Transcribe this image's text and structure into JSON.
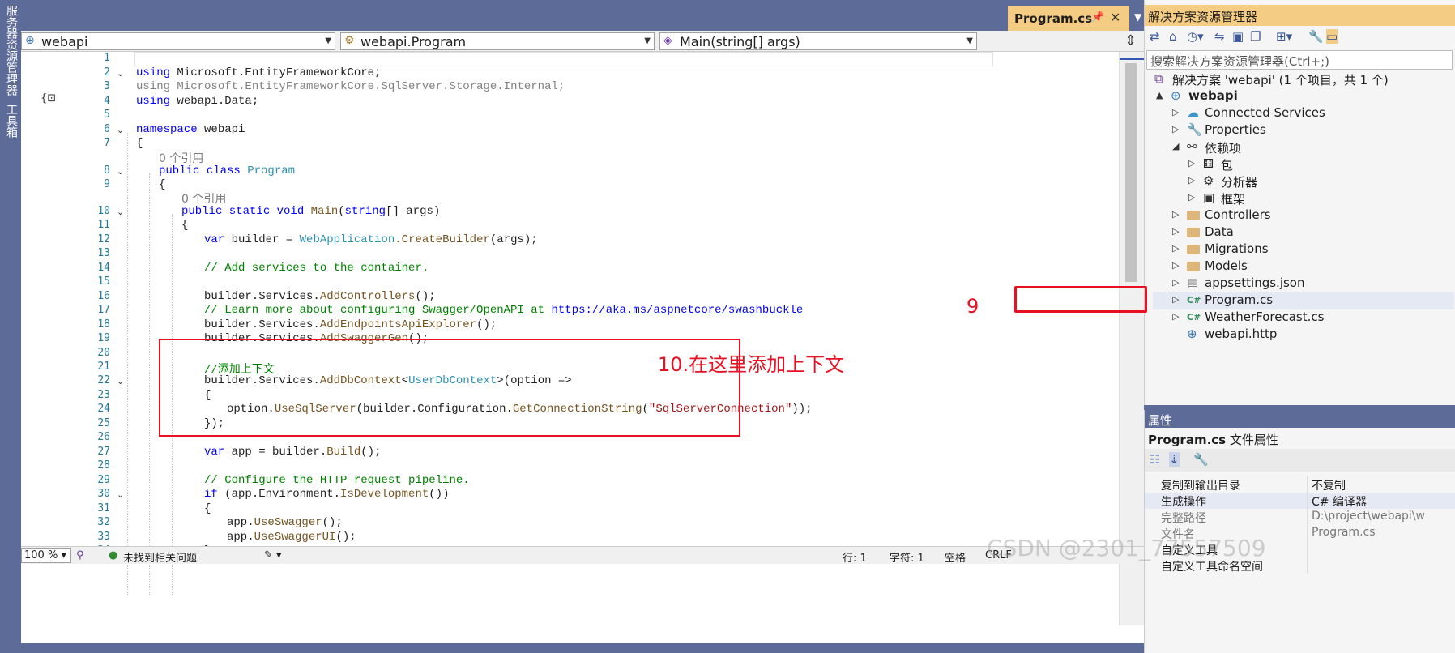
{
  "side_strip": {
    "server_explorer": "服务器资源管理器",
    "toolbox": "工具箱"
  },
  "tab": {
    "label": "Program.cs",
    "pin": "📌",
    "close": "✕"
  },
  "navbar": {
    "project": "webapi",
    "class": "webapi.Program",
    "member": "Main(string[] args)"
  },
  "line_numbers": [
    "1",
    "2",
    "3",
    "4",
    "5",
    "6",
    "7",
    "",
    "8",
    "9",
    "",
    "10",
    "11",
    "12",
    "13",
    "14",
    "15",
    "16",
    "17",
    "18",
    "19",
    "20",
    "21",
    "22",
    "23",
    "24",
    "25",
    "26",
    "27",
    "28",
    "29",
    "30",
    "31",
    "32",
    "33",
    "34"
  ],
  "code": {
    "l2a": "using",
    "l2b": " Microsoft.EntityFrameworkCore;",
    "l3": "using Microsoft.EntityFrameworkCore.SqlServer.Storage.Internal;",
    "l4a": "using",
    "l4b": " webapi.Data;",
    "l6a": "namespace",
    "l6b": " webapi",
    "l7": "{",
    "lens1": "0 个引用",
    "l8a": "public class ",
    "l8b": "Program",
    "l9": "{",
    "lens2": "0 个引用",
    "l10a": "public static void ",
    "l10b": "Main",
    "l10c": "(",
    "l10d": "string",
    "l10e": "[] args)",
    "l11": "{",
    "l12a": "var",
    "l12b": " builder = ",
    "l12c": "WebApplication",
    ".l12d": "",
    "l12e": ".CreateBuilder",
    "l12f": "(args);",
    "l14": "// Add services to the container.",
    "l16a": "builder.Services.",
    "l16b": "AddControllers",
    "l16c": "();",
    "l17a": "// Learn more about configuring Swagger/OpenAPI at ",
    "l17b": "https://aka.ms/aspnetcore/swashbuckle",
    "l18a": "builder.Services.",
    "l18b": "AddEndpointsApiExplorer",
    "l18c": "();",
    "l19a": "builder.Services.",
    "l19b": "AddSwaggerGen",
    "l19c": "();",
    "l21": "//添加上下文",
    "l22a": "builder.Services.",
    "l22b": "AddDbContext",
    "l22c": "<",
    "l22d": "UserDbContext",
    "l22e": ">(option =>",
    "l23": "{",
    "l24a": "option.",
    "l24b": "UseSqlServer",
    "l24c": "(builder.Configuration.",
    "l24d": "GetConnectionString",
    "l24e": "(",
    "l24f": "\"SqlServerConnection\"",
    "l24g": "));",
    "l25": "});",
    "l27a": "var",
    "l27b": " app = builder.",
    "l27c": "Build",
    "l27d": "();",
    "l29": "// Configure the HTTP request pipeline.",
    "l30a": "if",
    "l30b": " (app.Environment.",
    "l30c": "IsDevelopment",
    "l30d": "())",
    "l31": "{",
    "l32a": "app.",
    "l32b": "UseSwagger",
    "l32c": "();",
    "l33a": "app.",
    "l33b": "UseSwaggerUI",
    "l33c": "();",
    "l34": "}"
  },
  "annotations": {
    "step10": "10.在这里添加上下文",
    "step9": "9"
  },
  "status": {
    "zoom": "100 %",
    "issues": "未找到相关问题",
    "line": "行: 1",
    "char": "字符: 1",
    "space": "空格",
    "eol": "CRLF"
  },
  "solution_explorer": {
    "title": "解决方案资源管理器",
    "search_placeholder": "搜索解决方案资源管理器(Ctrl+;)",
    "items": [
      {
        "label": "解决方案 'webapi' (1 个项目，共 1 个)",
        "icon": "solution-icon"
      },
      {
        "label": "webapi",
        "icon": "project-icon"
      },
      {
        "label": "Connected Services",
        "icon": "cloud-icon"
      },
      {
        "label": "Properties",
        "icon": "wrench-icon"
      },
      {
        "label": "依赖项",
        "icon": "dependencies-icon"
      },
      {
        "label": "包",
        "icon": "package-icon"
      },
      {
        "label": "分析器",
        "icon": "analyzer-icon"
      },
      {
        "label": "框架",
        "icon": "framework-icon"
      },
      {
        "label": "Controllers",
        "icon": "folder-icon"
      },
      {
        "label": "Data",
        "icon": "folder-icon"
      },
      {
        "label": "Migrations",
        "icon": "folder-icon"
      },
      {
        "label": "Models",
        "icon": "folder-icon"
      },
      {
        "label": "appsettings.json",
        "icon": "json-icon"
      },
      {
        "label": "Program.cs",
        "icon": "csharp-icon"
      },
      {
        "label": "WeatherForecast.cs",
        "icon": "csharp-icon"
      },
      {
        "label": "webapi.http",
        "icon": "http-icon"
      }
    ]
  },
  "properties": {
    "title": "属性",
    "object_name": "Program.cs",
    "object_type": "文件属性",
    "rows": [
      {
        "k": "复制到输出目录",
        "v": "不复制"
      },
      {
        "k": "生成操作",
        "v": "C# 编译器"
      },
      {
        "k": "完整路径",
        "v": "D:\\project\\webapi\\w"
      },
      {
        "k": "文件名",
        "v": "Program.cs"
      },
      {
        "k": "自定义工具",
        "v": ""
      },
      {
        "k": "自定义工具命名空间",
        "v": ""
      }
    ]
  },
  "watermark": "CSDN @2301_77557509",
  "colors": {
    "accent_tab": "#f5cc84",
    "chrome": "#5d6b99",
    "annotation": "#e81123"
  }
}
